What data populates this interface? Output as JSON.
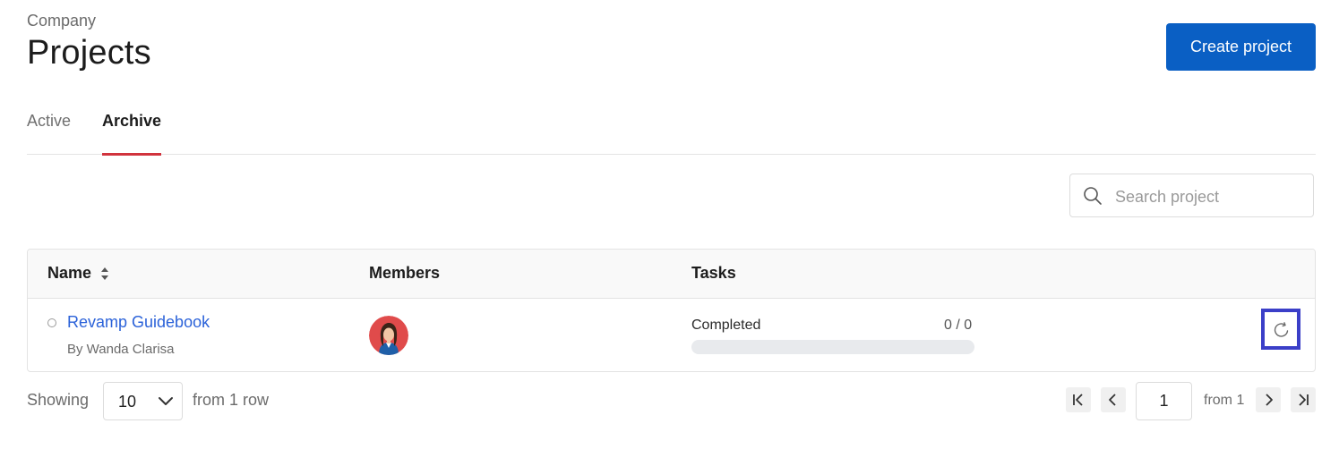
{
  "header": {
    "breadcrumb": "Company",
    "title": "Projects",
    "create_button_label": "Create project",
    "create_button_color": "#0a5fc4"
  },
  "tabs": [
    {
      "label": "Active",
      "active": false
    },
    {
      "label": "Archive",
      "active": true
    }
  ],
  "search": {
    "placeholder": "Search project",
    "value": "",
    "icon": "search-icon"
  },
  "table": {
    "columns": [
      "Name",
      "Members",
      "Tasks"
    ],
    "rows": [
      {
        "name": "Revamp Guidebook",
        "owner": "By Wanda Clarisa",
        "members": [
          "avatar-woman"
        ],
        "task_label": "Completed",
        "task_count": "0 / 0",
        "progress": 0,
        "action_icon": "restore-icon"
      }
    ]
  },
  "pagination": {
    "showing_label": "Showing",
    "page_size": "10",
    "rows_label": "from 1 row",
    "current_page": "1",
    "pages_label": "from 1"
  },
  "colors": {
    "accent": "#d1333d",
    "link": "#2b62d9",
    "focus_outline": "#3b3fc8"
  }
}
